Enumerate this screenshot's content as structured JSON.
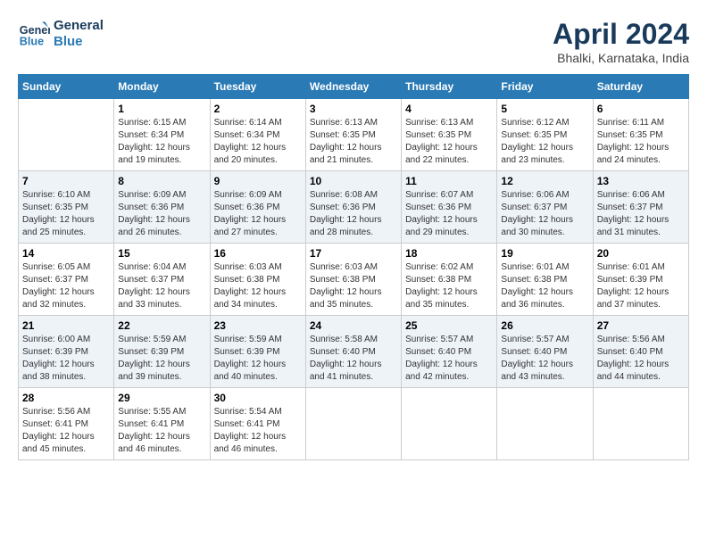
{
  "header": {
    "logo_line1": "General",
    "logo_line2": "Blue",
    "month_title": "April 2024",
    "subtitle": "Bhalki, Karnataka, India"
  },
  "weekdays": [
    "Sunday",
    "Monday",
    "Tuesday",
    "Wednesday",
    "Thursday",
    "Friday",
    "Saturday"
  ],
  "weeks": [
    [
      {
        "day": "",
        "sunrise": "",
        "sunset": "",
        "daylight": ""
      },
      {
        "day": "1",
        "sunrise": "Sunrise: 6:15 AM",
        "sunset": "Sunset: 6:34 PM",
        "daylight": "Daylight: 12 hours and 19 minutes."
      },
      {
        "day": "2",
        "sunrise": "Sunrise: 6:14 AM",
        "sunset": "Sunset: 6:34 PM",
        "daylight": "Daylight: 12 hours and 20 minutes."
      },
      {
        "day": "3",
        "sunrise": "Sunrise: 6:13 AM",
        "sunset": "Sunset: 6:35 PM",
        "daylight": "Daylight: 12 hours and 21 minutes."
      },
      {
        "day": "4",
        "sunrise": "Sunrise: 6:13 AM",
        "sunset": "Sunset: 6:35 PM",
        "daylight": "Daylight: 12 hours and 22 minutes."
      },
      {
        "day": "5",
        "sunrise": "Sunrise: 6:12 AM",
        "sunset": "Sunset: 6:35 PM",
        "daylight": "Daylight: 12 hours and 23 minutes."
      },
      {
        "day": "6",
        "sunrise": "Sunrise: 6:11 AM",
        "sunset": "Sunset: 6:35 PM",
        "daylight": "Daylight: 12 hours and 24 minutes."
      }
    ],
    [
      {
        "day": "7",
        "sunrise": "Sunrise: 6:10 AM",
        "sunset": "Sunset: 6:35 PM",
        "daylight": "Daylight: 12 hours and 25 minutes."
      },
      {
        "day": "8",
        "sunrise": "Sunrise: 6:09 AM",
        "sunset": "Sunset: 6:36 PM",
        "daylight": "Daylight: 12 hours and 26 minutes."
      },
      {
        "day": "9",
        "sunrise": "Sunrise: 6:09 AM",
        "sunset": "Sunset: 6:36 PM",
        "daylight": "Daylight: 12 hours and 27 minutes."
      },
      {
        "day": "10",
        "sunrise": "Sunrise: 6:08 AM",
        "sunset": "Sunset: 6:36 PM",
        "daylight": "Daylight: 12 hours and 28 minutes."
      },
      {
        "day": "11",
        "sunrise": "Sunrise: 6:07 AM",
        "sunset": "Sunset: 6:36 PM",
        "daylight": "Daylight: 12 hours and 29 minutes."
      },
      {
        "day": "12",
        "sunrise": "Sunrise: 6:06 AM",
        "sunset": "Sunset: 6:37 PM",
        "daylight": "Daylight: 12 hours and 30 minutes."
      },
      {
        "day": "13",
        "sunrise": "Sunrise: 6:06 AM",
        "sunset": "Sunset: 6:37 PM",
        "daylight": "Daylight: 12 hours and 31 minutes."
      }
    ],
    [
      {
        "day": "14",
        "sunrise": "Sunrise: 6:05 AM",
        "sunset": "Sunset: 6:37 PM",
        "daylight": "Daylight: 12 hours and 32 minutes."
      },
      {
        "day": "15",
        "sunrise": "Sunrise: 6:04 AM",
        "sunset": "Sunset: 6:37 PM",
        "daylight": "Daylight: 12 hours and 33 minutes."
      },
      {
        "day": "16",
        "sunrise": "Sunrise: 6:03 AM",
        "sunset": "Sunset: 6:38 PM",
        "daylight": "Daylight: 12 hours and 34 minutes."
      },
      {
        "day": "17",
        "sunrise": "Sunrise: 6:03 AM",
        "sunset": "Sunset: 6:38 PM",
        "daylight": "Daylight: 12 hours and 35 minutes."
      },
      {
        "day": "18",
        "sunrise": "Sunrise: 6:02 AM",
        "sunset": "Sunset: 6:38 PM",
        "daylight": "Daylight: 12 hours and 35 minutes."
      },
      {
        "day": "19",
        "sunrise": "Sunrise: 6:01 AM",
        "sunset": "Sunset: 6:38 PM",
        "daylight": "Daylight: 12 hours and 36 minutes."
      },
      {
        "day": "20",
        "sunrise": "Sunrise: 6:01 AM",
        "sunset": "Sunset: 6:39 PM",
        "daylight": "Daylight: 12 hours and 37 minutes."
      }
    ],
    [
      {
        "day": "21",
        "sunrise": "Sunrise: 6:00 AM",
        "sunset": "Sunset: 6:39 PM",
        "daylight": "Daylight: 12 hours and 38 minutes."
      },
      {
        "day": "22",
        "sunrise": "Sunrise: 5:59 AM",
        "sunset": "Sunset: 6:39 PM",
        "daylight": "Daylight: 12 hours and 39 minutes."
      },
      {
        "day": "23",
        "sunrise": "Sunrise: 5:59 AM",
        "sunset": "Sunset: 6:39 PM",
        "daylight": "Daylight: 12 hours and 40 minutes."
      },
      {
        "day": "24",
        "sunrise": "Sunrise: 5:58 AM",
        "sunset": "Sunset: 6:40 PM",
        "daylight": "Daylight: 12 hours and 41 minutes."
      },
      {
        "day": "25",
        "sunrise": "Sunrise: 5:57 AM",
        "sunset": "Sunset: 6:40 PM",
        "daylight": "Daylight: 12 hours and 42 minutes."
      },
      {
        "day": "26",
        "sunrise": "Sunrise: 5:57 AM",
        "sunset": "Sunset: 6:40 PM",
        "daylight": "Daylight: 12 hours and 43 minutes."
      },
      {
        "day": "27",
        "sunrise": "Sunrise: 5:56 AM",
        "sunset": "Sunset: 6:40 PM",
        "daylight": "Daylight: 12 hours and 44 minutes."
      }
    ],
    [
      {
        "day": "28",
        "sunrise": "Sunrise: 5:56 AM",
        "sunset": "Sunset: 6:41 PM",
        "daylight": "Daylight: 12 hours and 45 minutes."
      },
      {
        "day": "29",
        "sunrise": "Sunrise: 5:55 AM",
        "sunset": "Sunset: 6:41 PM",
        "daylight": "Daylight: 12 hours and 46 minutes."
      },
      {
        "day": "30",
        "sunrise": "Sunrise: 5:54 AM",
        "sunset": "Sunset: 6:41 PM",
        "daylight": "Daylight: 12 hours and 46 minutes."
      },
      {
        "day": "",
        "sunrise": "",
        "sunset": "",
        "daylight": ""
      },
      {
        "day": "",
        "sunrise": "",
        "sunset": "",
        "daylight": ""
      },
      {
        "day": "",
        "sunrise": "",
        "sunset": "",
        "daylight": ""
      },
      {
        "day": "",
        "sunrise": "",
        "sunset": "",
        "daylight": ""
      }
    ]
  ]
}
